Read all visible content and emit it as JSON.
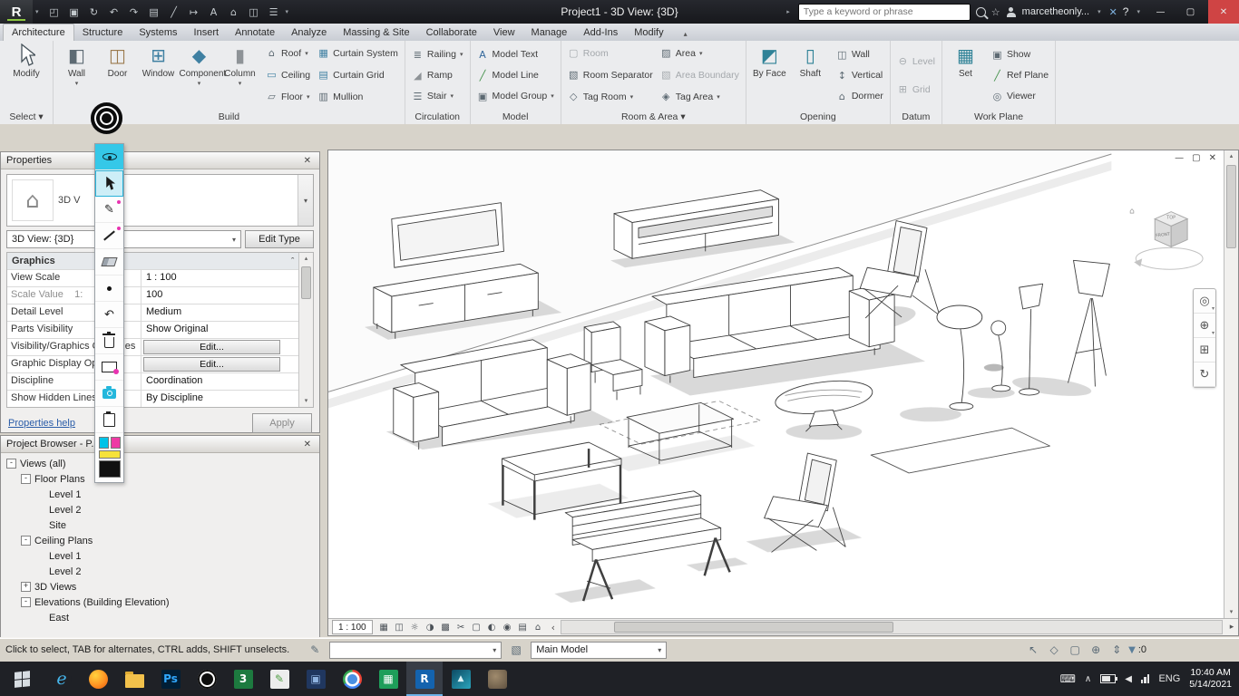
{
  "glyphs": {
    "caret_down": "▾",
    "caret_up": "▴",
    "chevron_left": "‹",
    "chevron_right": "›",
    "scroll_left": "◂",
    "scroll_right": "▸"
  },
  "title_bar": {
    "logo": "R",
    "qat": [
      {
        "name": "open-file",
        "glyph": "◰"
      },
      {
        "name": "save",
        "glyph": "▣"
      },
      {
        "name": "sync-with-central",
        "glyph": "↻"
      },
      {
        "name": "undo",
        "glyph": "↶"
      },
      {
        "name": "redo",
        "glyph": "↷"
      },
      {
        "name": "print",
        "glyph": "▤"
      },
      {
        "name": "measure",
        "glyph": "╱"
      },
      {
        "name": "aligned-dimension",
        "glyph": "↦"
      },
      {
        "name": "text-note",
        "glyph": "A"
      },
      {
        "name": "default-3d-view",
        "glyph": "⌂"
      },
      {
        "name": "section",
        "glyph": "◫"
      },
      {
        "name": "thin-lines",
        "glyph": "☰"
      }
    ],
    "title": "Project1 - 3D View: {3D}",
    "pre_search_caret": "▸",
    "search_placeholder": "Type a keyword or phrase",
    "sign_in_star": "☆",
    "user": "marcetheonly...",
    "x_button": "✕",
    "help": "?",
    "window": {
      "minimize": "—",
      "restore": "▢",
      "close": "✕"
    }
  },
  "ribbon": {
    "tabs": [
      {
        "label": "Architecture",
        "active": true
      },
      {
        "label": "Structure"
      },
      {
        "label": "Systems"
      },
      {
        "label": "Insert"
      },
      {
        "label": "Annotate"
      },
      {
        "label": "Analyze"
      },
      {
        "label": "Massing & Site"
      },
      {
        "label": "Collaborate"
      },
      {
        "label": "View"
      },
      {
        "label": "Manage"
      },
      {
        "label": "Add-Ins"
      },
      {
        "label": "Modify"
      }
    ],
    "minimize_glyph": "▴",
    "select": {
      "label": "Select ▾",
      "modify_label": "Modify"
    },
    "build": {
      "label": "Build",
      "big": [
        {
          "label": "Wall",
          "glyph": "◧",
          "color": "#5d6a73",
          "caret": true
        },
        {
          "label": "Door",
          "glyph": "◫",
          "color": "#9b7a4e"
        },
        {
          "label": "Window",
          "glyph": "⊞",
          "color": "#3f80a2"
        },
        {
          "label": "Component",
          "glyph": "◆",
          "color": "#3f80a2",
          "caret": true
        },
        {
          "label": "Column",
          "glyph": "▮",
          "color": "#8e9397",
          "caret": true
        }
      ],
      "small": [
        {
          "label": "Roof",
          "glyph": "⌂",
          "color": "#5d6a73",
          "caret": true
        },
        {
          "label": "Ceiling",
          "glyph": "▭",
          "color": "#3f80a2"
        },
        {
          "label": "Floor",
          "glyph": "▱",
          "color": "#5d6a73",
          "caret": true
        },
        {
          "label": "Curtain System",
          "glyph": "▦",
          "color": "#3f80a2"
        },
        {
          "label": "Curtain Grid",
          "glyph": "▤",
          "color": "#3f80a2"
        },
        {
          "label": "Mullion",
          "glyph": "▥",
          "color": "#5d6a73"
        }
      ]
    },
    "circulation": {
      "label": "Circulation",
      "items": [
        {
          "label": "Railing",
          "glyph": "≣",
          "color": "#5d6a73",
          "caret": true
        },
        {
          "label": "Ramp",
          "glyph": "◢",
          "color": "#8e9397"
        },
        {
          "label": "Stair",
          "glyph": "☰",
          "color": "#5d6a73",
          "caret": true
        }
      ]
    },
    "model": {
      "label": "Model",
      "items": [
        {
          "label": "Model Text",
          "glyph": "A",
          "color": "#33679b"
        },
        {
          "label": "Model Line",
          "glyph": "╱",
          "color": "#3f8f46"
        },
        {
          "label": "Model Group",
          "glyph": "▣",
          "color": "#5d6a73",
          "caret": true
        }
      ]
    },
    "room_area": {
      "label": "Room & Area ▾",
      "items": [
        {
          "label": "Room",
          "glyph": "▢",
          "color": "#a6abaf",
          "disabled": true
        },
        {
          "label": "Room Separator",
          "glyph": "▧",
          "color": "#5d6a73"
        },
        {
          "label": "Tag Room",
          "glyph": "◇",
          "color": "#5d6a73",
          "caret": true
        },
        {
          "label": "Area",
          "glyph": "▨",
          "color": "#5d6a73",
          "caret": true
        },
        {
          "label": "Area Boundary",
          "glyph": "▧",
          "color": "#a6abaf",
          "disabled": true
        },
        {
          "label": "Tag Area",
          "glyph": "◈",
          "color": "#5d6a73",
          "caret": true
        }
      ]
    },
    "opening": {
      "label": "Opening",
      "big": [
        {
          "label": "By Face",
          "glyph": "◩",
          "color": "#2f8297"
        },
        {
          "label": "Shaft",
          "glyph": "▯",
          "color": "#2f8297"
        }
      ],
      "items": [
        {
          "label": "Wall",
          "glyph": "◫",
          "color": "#5d6a73"
        },
        {
          "label": "Vertical",
          "glyph": "↕",
          "color": "#5d6a73"
        },
        {
          "label": "Dormer",
          "glyph": "⌂",
          "color": "#5d6a73"
        }
      ]
    },
    "datum": {
      "label": "Datum",
      "items": [
        {
          "label": "Level",
          "glyph": "⊖",
          "color": "#a6abaf",
          "disabled": true
        },
        {
          "label": "Grid",
          "glyph": "⊞",
          "color": "#a6abaf",
          "disabled": true
        }
      ]
    },
    "work_plane": {
      "label": "Work Plane",
      "big": [
        {
          "label": "Set",
          "glyph": "▦",
          "color": "#2f8297"
        }
      ],
      "items": [
        {
          "label": "Show",
          "glyph": "▣",
          "color": "#5d6a73"
        },
        {
          "label": "Ref Plane",
          "glyph": "╱",
          "color": "#3f8f46"
        },
        {
          "label": "Viewer",
          "glyph": "◎",
          "color": "#5d6a73"
        }
      ]
    }
  },
  "properties": {
    "header": "Properties",
    "close": "✕",
    "type_label": "3D V",
    "type_icon": "⌂",
    "selector_value": "3D View: {3D}",
    "edit_type": "Edit Type",
    "category": "Graphics",
    "collapse": "ˆ",
    "rows": [
      {
        "label": "View Scale",
        "value": "1 : 100"
      },
      {
        "label": "Scale Value    1:",
        "value": "100",
        "disabled": true
      },
      {
        "label": "Detail Level",
        "value": "Medium"
      },
      {
        "label": "Parts Visibility",
        "value": "Show Original"
      },
      {
        "label": "Visibility/Graphics Overrides",
        "value": "Edit...",
        "button": true
      },
      {
        "label": "Graphic Display Options",
        "value": "Edit...",
        "button": true
      },
      {
        "label": "Discipline",
        "value": "Coordination"
      },
      {
        "label": "Show Hidden Lines",
        "value": "By Discipline"
      }
    ],
    "help_link": "Properties help",
    "apply": "Apply"
  },
  "project_browser": {
    "header": "Project Browser - P...",
    "close": "✕",
    "tree": [
      {
        "label": "Views (all)",
        "indent": 0,
        "exp": "-"
      },
      {
        "label": "Floor Plans",
        "indent": 1,
        "exp": "-"
      },
      {
        "label": "Level 1",
        "indent": 2,
        "exp": ""
      },
      {
        "label": "Level 2",
        "indent": 2,
        "exp": ""
      },
      {
        "label": "Site",
        "indent": 2,
        "exp": ""
      },
      {
        "label": "Ceiling Plans",
        "indent": 1,
        "exp": "-"
      },
      {
        "label": "Level 1",
        "indent": 2,
        "exp": ""
      },
      {
        "label": "Level 2",
        "indent": 2,
        "exp": ""
      },
      {
        "label": "3D Views",
        "indent": 1,
        "exp": "+"
      },
      {
        "label": "Elevations (Building Elevation)",
        "indent": 1,
        "exp": "-"
      },
      {
        "label": "East",
        "indent": 2,
        "exp": ""
      }
    ]
  },
  "annotation_toolbar": {
    "tools": [
      "overlay-visibility",
      "select-cursor",
      "pen",
      "line",
      "eraser",
      "brush-size",
      "undo",
      "clear-all",
      "whiteboard",
      "screenshot-camera",
      "notes"
    ],
    "selected_tool": "select-cursor",
    "swatches": [
      "#00c3e8",
      "#ee3aa4",
      "#f6e23a",
      "#111111"
    ]
  },
  "canvas": {
    "window_controls": {
      "minimize": "—",
      "restore": "▢",
      "close": "✕"
    },
    "viewcube": {
      "home": "⌂",
      "top": "TOP",
      "front": "FRONT"
    },
    "nav": [
      {
        "name": "full-navigation-wheel",
        "glyph": "◎",
        "caret": true
      },
      {
        "name": "zoom",
        "glyph": "⊕",
        "caret": true
      },
      {
        "name": "pan",
        "glyph": "⊞"
      },
      {
        "name": "orbit",
        "glyph": "↻"
      }
    ],
    "view_scale": "1 : 100",
    "view_controls": [
      {
        "name": "detail-level",
        "glyph": "▦"
      },
      {
        "name": "visual-style",
        "glyph": "◫"
      },
      {
        "name": "sun-path",
        "glyph": "☼"
      },
      {
        "name": "shadows",
        "glyph": "◑"
      },
      {
        "name": "rendering-dialog",
        "glyph": "▩"
      },
      {
        "name": "crop-view",
        "glyph": "✂"
      },
      {
        "name": "show-crop-region",
        "glyph": "▢"
      },
      {
        "name": "temporary-hide-isolate",
        "glyph": "◐"
      },
      {
        "name": "reveal-hidden-elements",
        "glyph": "◉"
      },
      {
        "name": "worksharing-display",
        "glyph": "▤"
      },
      {
        "name": "displaced-elements",
        "glyph": "⌂"
      }
    ]
  },
  "status_bar": {
    "message": "Click to select, TAB for alternates, CTRL adds, SHIFT unselects.",
    "workset_value": "",
    "design_option": "Main Model",
    "right_icons": [
      {
        "name": "select-links",
        "glyph": "↖"
      },
      {
        "name": "select-underlay-elements",
        "glyph": "◇"
      },
      {
        "name": "select-pinned-elements",
        "glyph": "▢"
      },
      {
        "name": "select-elements-by-face",
        "glyph": "⊕"
      },
      {
        "name": "drag-elements-on-selection",
        "glyph": "⇕"
      }
    ],
    "filter_glyph": "▼",
    "filter_count": ":0"
  },
  "taskbar": {
    "apps": [
      {
        "name": "internet-explorer",
        "glyph": "e",
        "bg": "#1f2126",
        "fg": "#45b5ea"
      },
      {
        "name": "firefox",
        "glyph": "",
        "bg": "#e8641b",
        "fg": "#ffffff"
      },
      {
        "name": "file-explorer",
        "glyph": "",
        "bg": "#f2c14b",
        "fg": "#7a5b1e"
      },
      {
        "name": "photoshop",
        "glyph": "Ps",
        "bg": "#001e36",
        "fg": "#31a8ff"
      },
      {
        "name": "epic-pen",
        "glyph": "",
        "bg": "#0d0d0d",
        "fg": "#ffffff"
      },
      {
        "name": "app-three",
        "glyph": "3",
        "bg": "#1d7a3f",
        "fg": "#ffffff"
      },
      {
        "name": "annotation-app",
        "glyph": "✎",
        "bg": "#ededed",
        "fg": "#4f9e43"
      },
      {
        "name": "blue-app",
        "glyph": "▣",
        "bg": "#20375f",
        "fg": "#8fb3e0"
      },
      {
        "name": "chrome",
        "glyph": "",
        "bg": "#de4b3b",
        "fg": "#ffffff"
      },
      {
        "name": "spreadsheet-app",
        "glyph": "▦",
        "bg": "#1e9e5a",
        "fg": "#ffffff"
      },
      {
        "name": "revit",
        "glyph": "R",
        "bg": "#1463ae",
        "fg": "#ffffff",
        "active": true
      },
      {
        "name": "photos",
        "glyph": "▲",
        "bg": "#157a96",
        "fg": "#d9f1f6"
      },
      {
        "name": "image-thumbnail",
        "glyph": "",
        "bg": "#7d6b54",
        "fg": "#ffffff"
      }
    ],
    "tray": {
      "keyboard": "⌨",
      "expand": "∧",
      "speaker": "◀",
      "lang": "ENG",
      "time": "10:40 AM",
      "date": "5/14/2021"
    }
  }
}
